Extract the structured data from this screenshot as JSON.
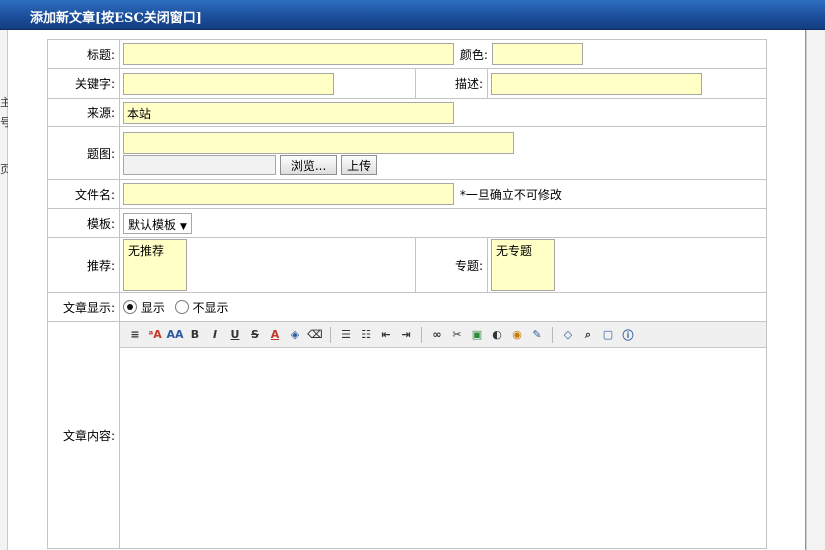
{
  "window": {
    "title": "添加新文章[按ESC关闭窗口]"
  },
  "background": {
    "fragments": [
      "主",
      "号",
      "页"
    ]
  },
  "form": {
    "title_label": "标题:",
    "color_label": "颜色:",
    "keywords_label": "关键字:",
    "description_label": "描述:",
    "source_label": "来源:",
    "source_value": "本站",
    "image_label": "题图:",
    "browse_button": "浏览...",
    "upload_button": "上传",
    "filename_label": "文件名:",
    "filename_note": "*一旦确立不可修改",
    "template_label": "模板:",
    "template_value": "默认模板",
    "recommend_label": "推荐:",
    "recommend_option": "无推荐",
    "topic_label": "专题:",
    "topic_option": "无专题",
    "display_label": "文章显示:",
    "display_show": "显示",
    "display_hide": "不显示",
    "content_label": "文章内容:"
  },
  "toolbar": {
    "bold": "B",
    "italic": "I",
    "underline": "U",
    "strike": "S",
    "font_color": "A"
  }
}
